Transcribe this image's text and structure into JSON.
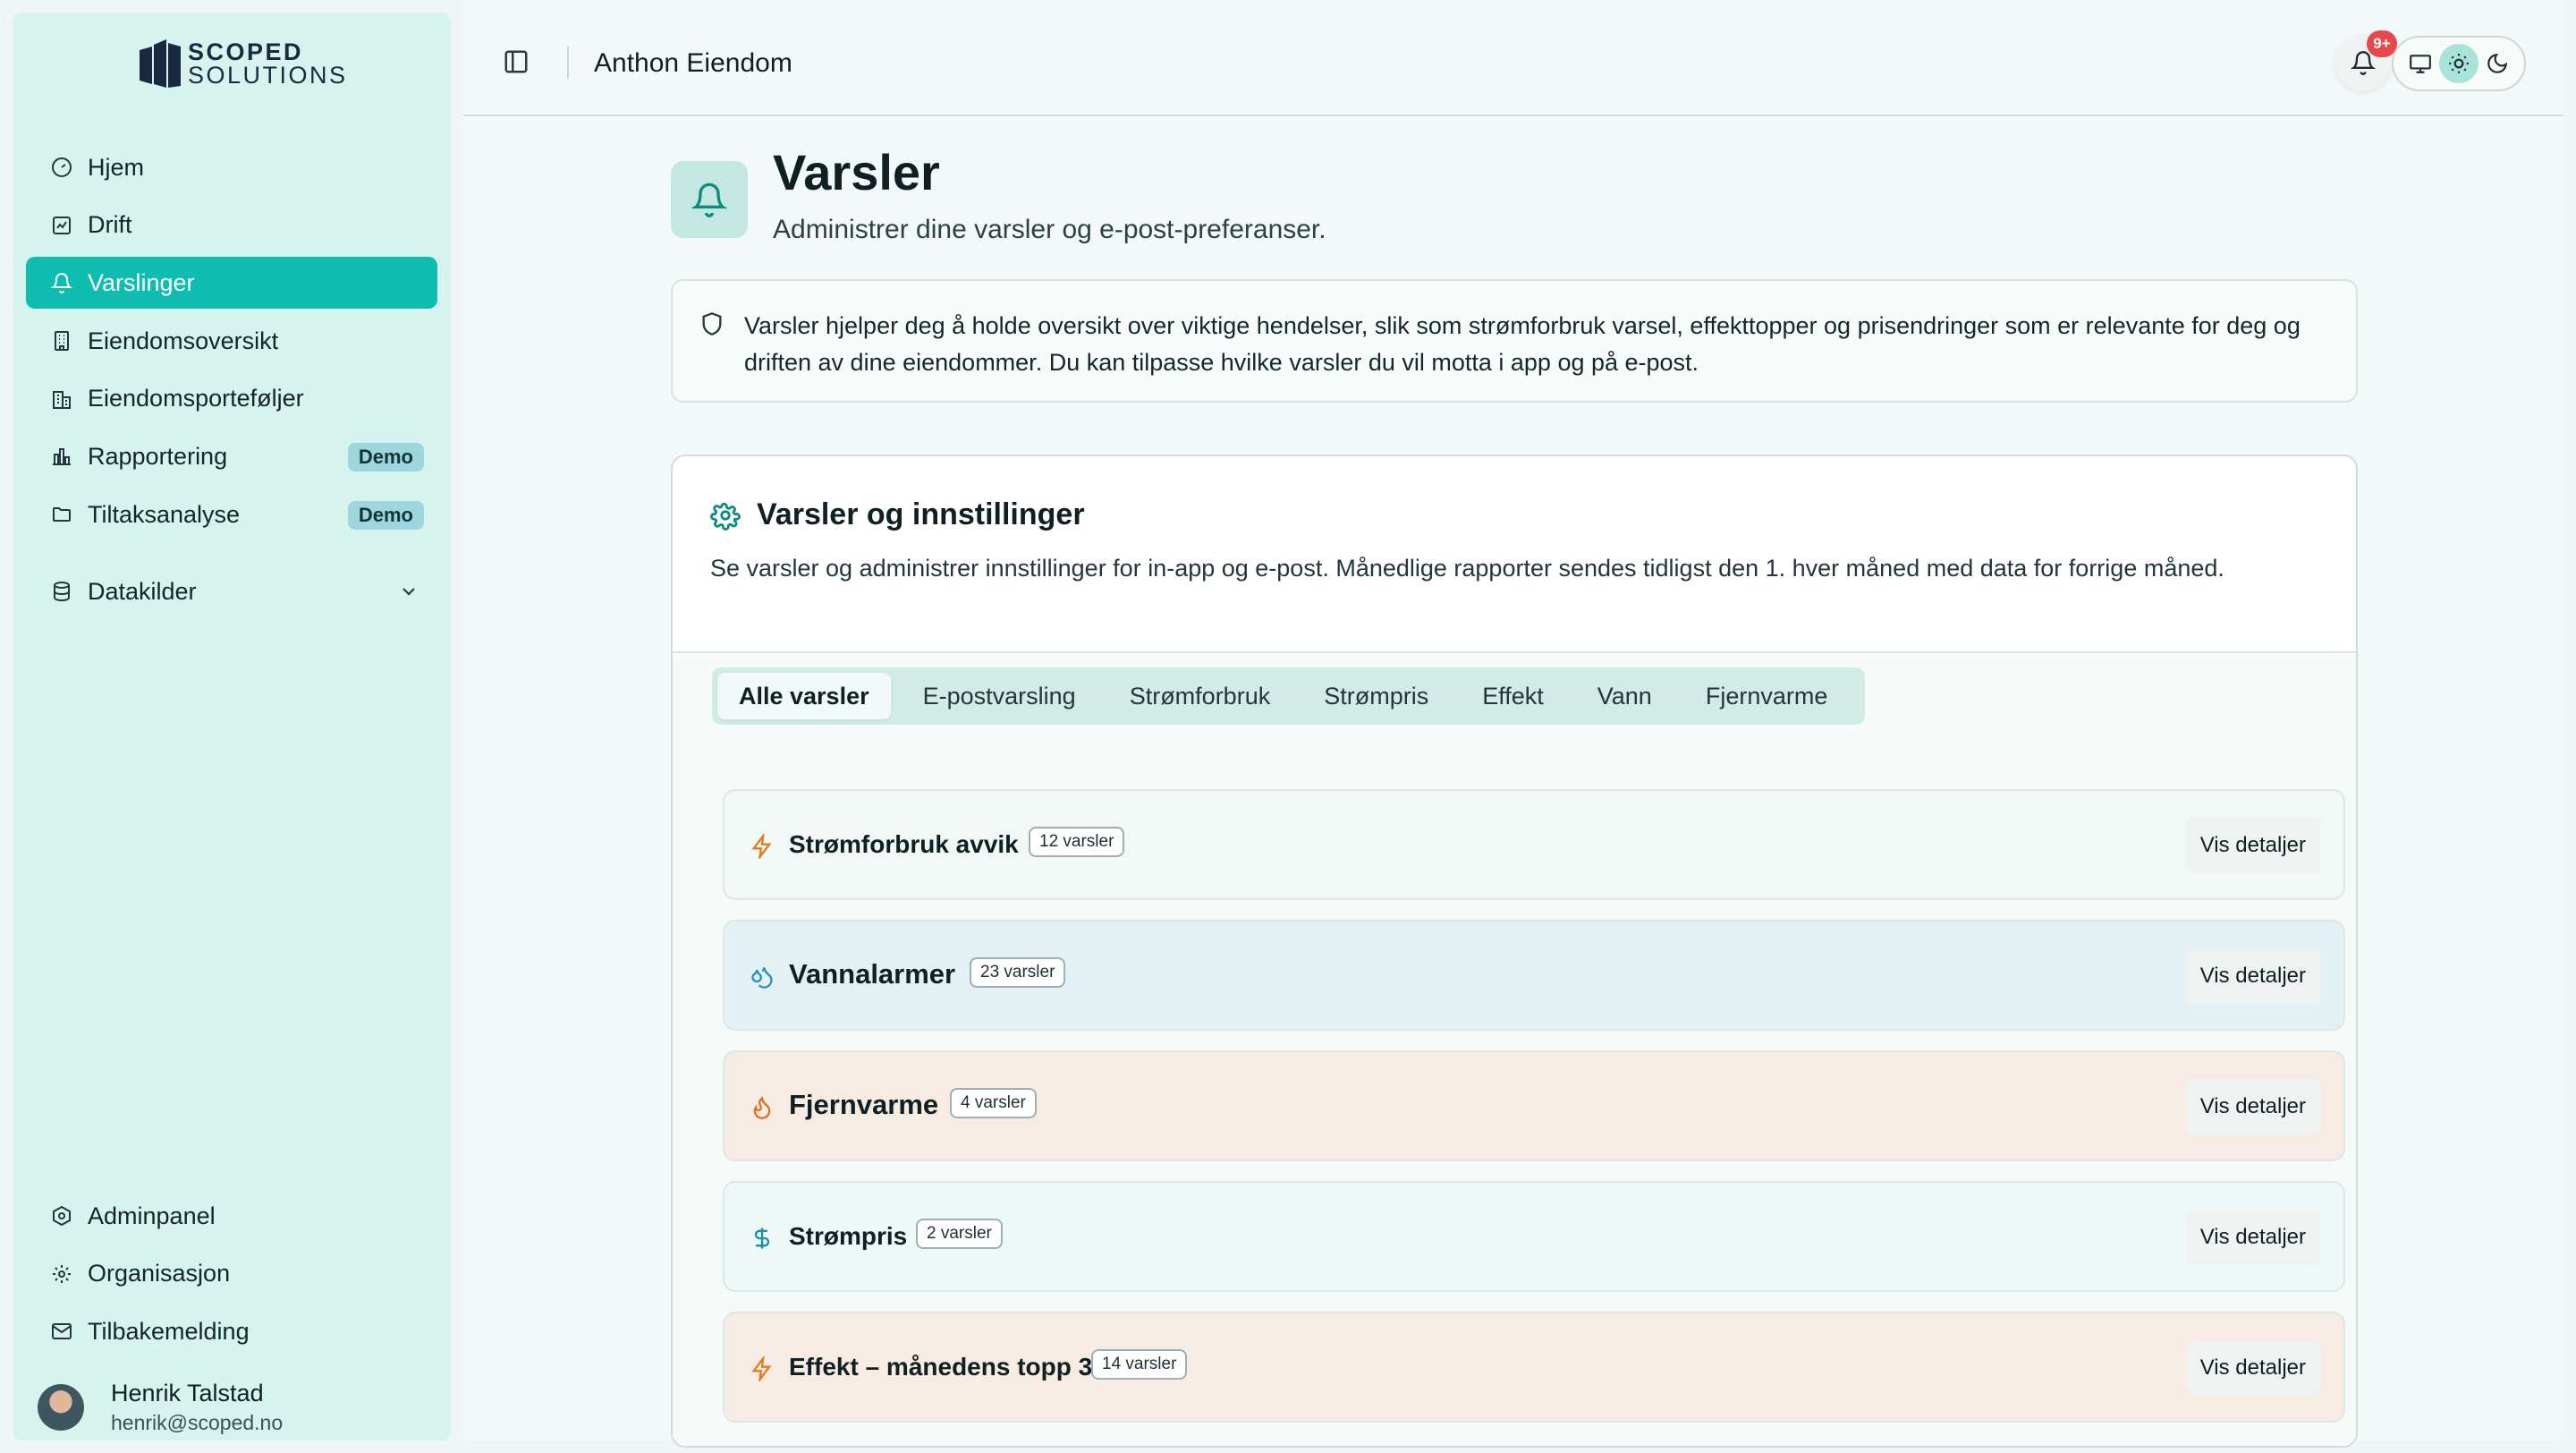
{
  "app": {
    "logo_line1": "SCOPED",
    "logo_line2": "SOLUTIONS",
    "org_name": "Anthon Eiendom"
  },
  "sidebar": {
    "items": [
      {
        "label": "Hjem",
        "icon": "gauge-icon"
      },
      {
        "label": "Drift",
        "icon": "chart-line-icon"
      },
      {
        "label": "Varslinger",
        "icon": "bell-icon",
        "active": true
      },
      {
        "label": "Eiendomsoversikt",
        "icon": "building-icon"
      },
      {
        "label": "Eiendomsporteføljer",
        "icon": "buildings-icon"
      },
      {
        "label": "Rapportering",
        "icon": "bar-chart-icon",
        "badge": "Demo"
      },
      {
        "label": "Tiltaksanalyse",
        "icon": "folder-icon",
        "badge": "Demo"
      },
      {
        "label": "Datakilder",
        "icon": "database-icon"
      }
    ],
    "bottom_items": [
      {
        "label": "Adminpanel",
        "icon": "hexagon-gear-icon"
      },
      {
        "label": "Organisasjon",
        "icon": "settings-icon"
      },
      {
        "label": "Tilbakemelding",
        "icon": "mail-icon"
      }
    ],
    "user": {
      "name": "Henrik Talstad",
      "email": "henrik@scoped.no"
    }
  },
  "topbar": {
    "notification_count": "9+"
  },
  "page": {
    "title": "Varsler",
    "subtitle": "Administrer dine varsler og e-post-preferanser.",
    "info_text": "Varsler hjelper deg å holde oversikt over viktige hendelser, slik som strømforbruk varsel, effekttopper og prisendringer som er relevante for deg og driften av dine eiendommer. Du kan tilpasse hvilke varsler du vil motta i app og på e-post."
  },
  "card": {
    "title": "Varsler og innstillinger",
    "description": "Se varsler og administrer innstillinger for in-app og e-post. Månedlige rapporter sendes tidligst den 1. hver måned med data for forrige måned.",
    "tabs": [
      "Alle varsler",
      "E-postvarsling",
      "Strømforbruk",
      "Strømpris",
      "Effekt",
      "Vann",
      "Fjernvarme"
    ],
    "alerts": [
      {
        "title": "Strømforbruk avvik",
        "count": "12 varsler",
        "button": "Vis detaljer",
        "icon": "zap-icon",
        "bg": "#f1f8f6",
        "icon_color": "#e07b1f"
      },
      {
        "title": "Vannalarmer",
        "count": "23 varsler",
        "button": "Vis detaljer",
        "icon": "droplets-icon",
        "bg": "#e3f1f5",
        "icon_color": "#2b8fb3"
      },
      {
        "title": "Fjernvarme",
        "count": "4 varsler",
        "button": "Vis detaljer",
        "icon": "flame-icon",
        "bg": "#f6ece3",
        "icon_color": "#e0711f"
      },
      {
        "title": "Strømpris",
        "count": "2 varsler",
        "button": "Vis detaljer",
        "icon": "dollar-icon",
        "bg": "#eef8f9",
        "icon_color": "#1b8fa6"
      },
      {
        "title": "Effekt – månedens topp 3",
        "count": "14 varsler",
        "button": "Vis detaljer",
        "icon": "zap-icon",
        "bg": "#f6ece3",
        "icon_color": "#e07b1f"
      }
    ]
  }
}
